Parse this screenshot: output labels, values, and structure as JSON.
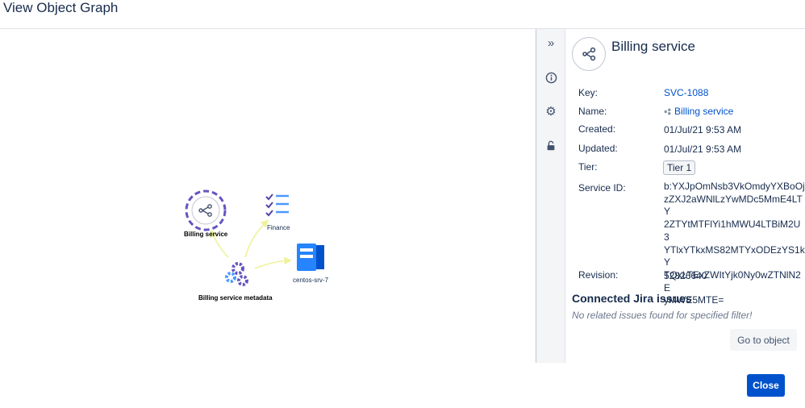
{
  "dialog": {
    "title": "View Object Graph"
  },
  "graph": {
    "nodes": [
      {
        "id": "billing-service",
        "label": "Billing service"
      },
      {
        "id": "finance",
        "label": "Finance"
      },
      {
        "id": "billing-service-metadata",
        "label": "Billing service metadata"
      },
      {
        "id": "centos-srv-7",
        "label": "centos-srv-7"
      }
    ],
    "edge_color": "#eef29a",
    "selection_color": "#6554c0"
  },
  "toolbar": {
    "icons": [
      "double-chevron-right-icon",
      "info-icon",
      "gear-icon",
      "unlock-icon"
    ]
  },
  "panel": {
    "object_title": "Billing service",
    "attributes": {
      "key_label": "Key:",
      "key_value": "SVC-1088",
      "name_label": "Name:",
      "name_value": "Billing service",
      "created_label": "Created:",
      "created_value": "01/Jul/21 9:53 AM",
      "updated_label": "Updated:",
      "updated_value": "01/Jul/21 9:53 AM",
      "tier_label": "Tier:",
      "tier_value": "Tier 1",
      "service_id_label": "Service ID:",
      "service_id_lines": [
        "b:YXJpOmNsb3VkOmdyYXBoOj",
        "zZXJ2aWNlLzYwMDc5MmE4LTY",
        "2ZTYtMTFlYi1hMWU4LTBiM2U3",
        "YTlxYTkxMS82MTYxODEzYS1kY",
        "TQxLTExZWItYjk0Ny0wZTNlN2E",
        "yMWE5MTE="
      ],
      "revision_label": "Revision:",
      "revision_value": "52826640"
    },
    "connected_title": "Connected Jira issues",
    "empty_message": "No related issues found for specified filter!",
    "goto_label": "Go to object"
  },
  "footer": {
    "close_label": "Close"
  },
  "colors": {
    "primary": "#0052cc",
    "link": "#0052cc",
    "text": "#172b4d"
  }
}
